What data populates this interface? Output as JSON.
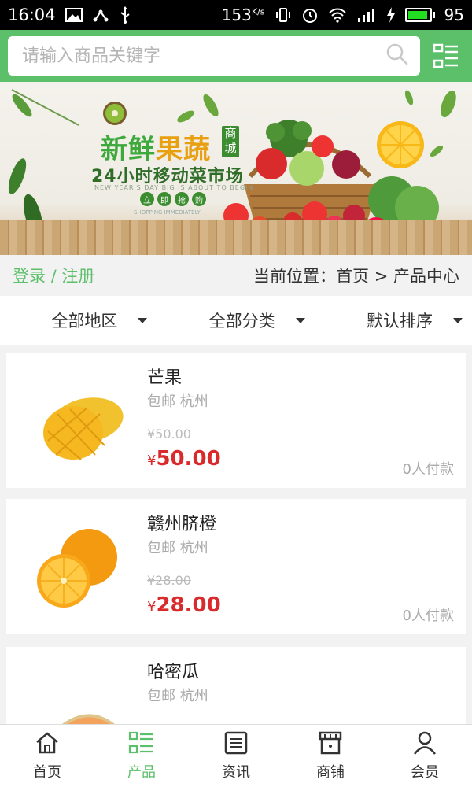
{
  "status_bar": {
    "time": "16:04",
    "network_speed": "153",
    "network_unit": "K/s",
    "battery_level": "95",
    "battery_fraction": 0.95
  },
  "search": {
    "placeholder": "请输入商品关键字"
  },
  "banner": {
    "title_part1": "新鲜",
    "title_part2": "果蔬",
    "badge": "商城",
    "subtitle": "24小时移动菜市场",
    "english_line": "NEW YEAR'S DAY BIG IS ABOUT TO BEGIN",
    "cta": [
      "立",
      "即",
      "抢",
      "购"
    ],
    "tagline": "SHOPPING IMMEDIATELY"
  },
  "location_row": {
    "login_link": "登录 / 注册",
    "breadcrumb": "当前位置：首页 > 产品中心"
  },
  "filters": [
    {
      "label": "全部地区"
    },
    {
      "label": "全部分类"
    },
    {
      "label": "默认排序"
    }
  ],
  "products": [
    {
      "name": "芒果",
      "shipping": "包邮 杭州",
      "original_price": "¥50.00",
      "price_symbol": "¥",
      "price": "50.00",
      "paid_count": "0人付款",
      "icon": "mango-image"
    },
    {
      "name": "赣州脐橙",
      "shipping": "包邮 杭州",
      "original_price": "¥28.00",
      "price_symbol": "¥",
      "price": "28.00",
      "paid_count": "0人付款",
      "icon": "orange-image"
    },
    {
      "name": "哈密瓜",
      "shipping": "包邮 杭州",
      "icon": "cantaloupe-image"
    }
  ],
  "bottom_nav": [
    {
      "label": "首页",
      "icon": "home-icon"
    },
    {
      "label": "产品",
      "icon": "list-icon",
      "active": true
    },
    {
      "label": "资讯",
      "icon": "news-icon"
    },
    {
      "label": "商铺",
      "icon": "shop-icon"
    },
    {
      "label": "会员",
      "icon": "user-icon"
    }
  ],
  "colors": {
    "brand_green": "#5cbf6a",
    "price_red": "#d92b2b"
  }
}
